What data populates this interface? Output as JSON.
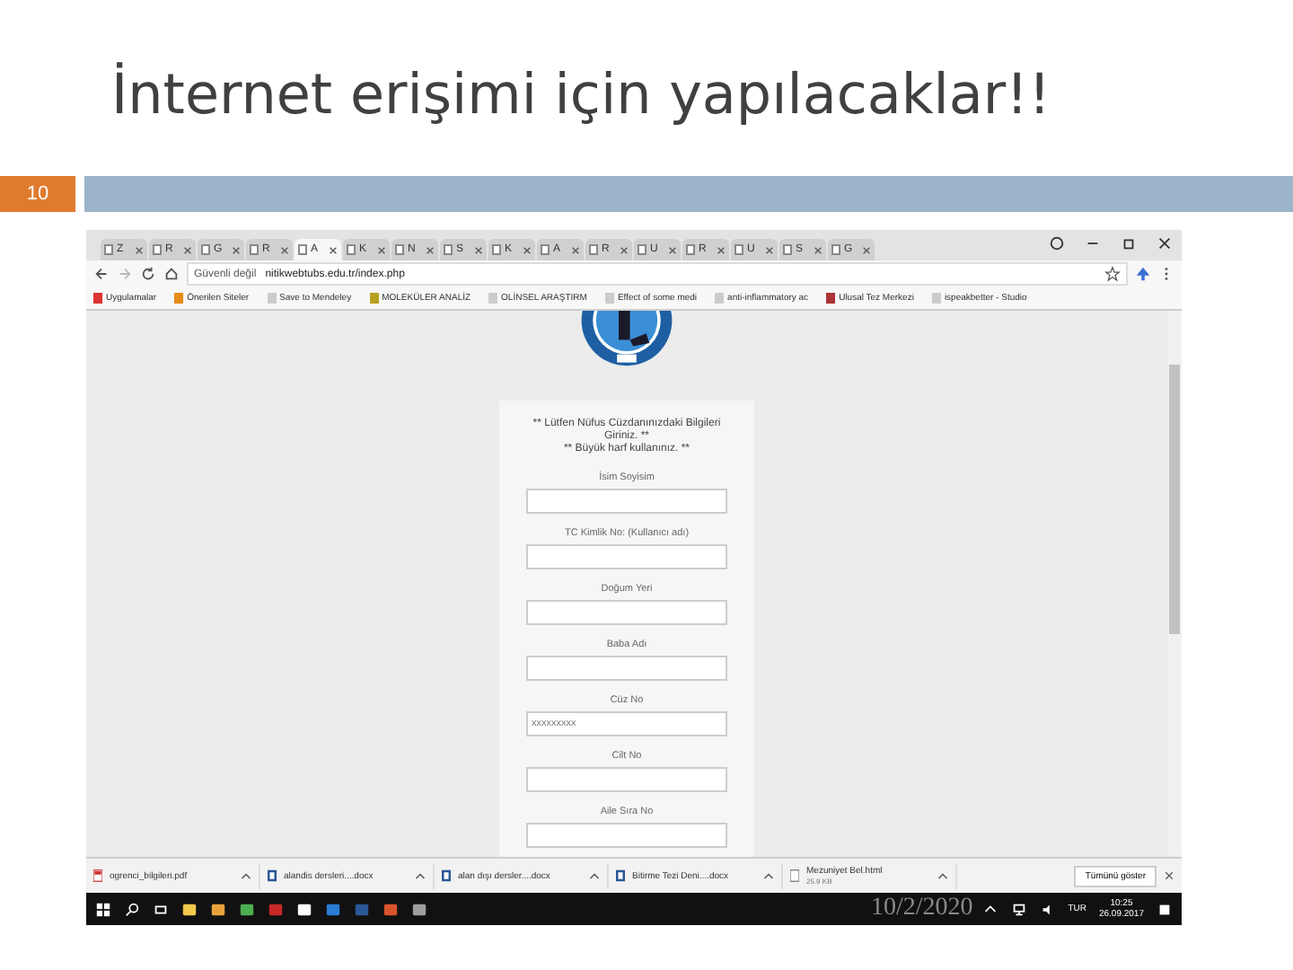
{
  "slide": {
    "title": "İnternet erişimi için yapılacaklar!!",
    "number": "10",
    "footer_date": "10/2/2020"
  },
  "browser": {
    "tabs": [
      {
        "label": "Z",
        "selected": false
      },
      {
        "label": "R",
        "selected": false
      },
      {
        "label": "G",
        "selected": false
      },
      {
        "label": "R",
        "selected": false
      },
      {
        "label": "A",
        "selected": true
      },
      {
        "label": "K",
        "selected": false
      },
      {
        "label": "N",
        "selected": false
      },
      {
        "label": "S",
        "selected": false
      },
      {
        "label": "K",
        "selected": false
      },
      {
        "label": "A",
        "selected": false
      },
      {
        "label": "R",
        "selected": false
      },
      {
        "label": "U",
        "selected": false
      },
      {
        "label": "R",
        "selected": false
      },
      {
        "label": "U",
        "selected": false
      },
      {
        "label": "S",
        "selected": false
      },
      {
        "label": "G",
        "selected": false
      }
    ],
    "security": "Güvenli değil",
    "url": "nitikwebtubs.edu.tr/index.php",
    "bookmarks": [
      "Uygulamalar",
      "Önerilen Siteler",
      "Save to Mendeley",
      "MOLEKÜLER ANALİZ",
      "OLİNSEL ARAŞTIRM",
      "Effect of some medi",
      "anti-inflammatory ac",
      "Ulusal Tez Merkezi",
      "ispeakbetter - Studio"
    ]
  },
  "form": {
    "notes": [
      "** Lütfen Nüfus Cüzdanınızdaki Bilgileri Giriniz. **",
      "** Büyük harf kullanınız. **"
    ],
    "fields": [
      {
        "label": "İsim Soyisim"
      },
      {
        "label": "TC Kimlik No: (Kullanıcı adı)"
      },
      {
        "label": "Doğum Yeri"
      },
      {
        "label": "Baba Adı"
      },
      {
        "label": "Cüz No",
        "placeholder": "xxxxxxxxx"
      },
      {
        "label": "Cilt No"
      },
      {
        "label": "Aile Sıra No"
      }
    ]
  },
  "downloads": {
    "items": [
      {
        "kind": "pdf",
        "name": "ogrenci_bilgileri.pdf"
      },
      {
        "kind": "doc",
        "name": "alandis dersleri....docx"
      },
      {
        "kind": "doc",
        "name": "alan dışı dersler....docx"
      },
      {
        "kind": "doc",
        "name": "Bitirme Tezi Deni....docx"
      },
      {
        "kind": "html",
        "name": "Mezuniyet Bel.html",
        "detail": "25.9 KB"
      }
    ],
    "show_all": "Tümünü göster"
  },
  "taskbar": {
    "language": "TUR",
    "time": "10:25",
    "date": "26.09.2017"
  }
}
